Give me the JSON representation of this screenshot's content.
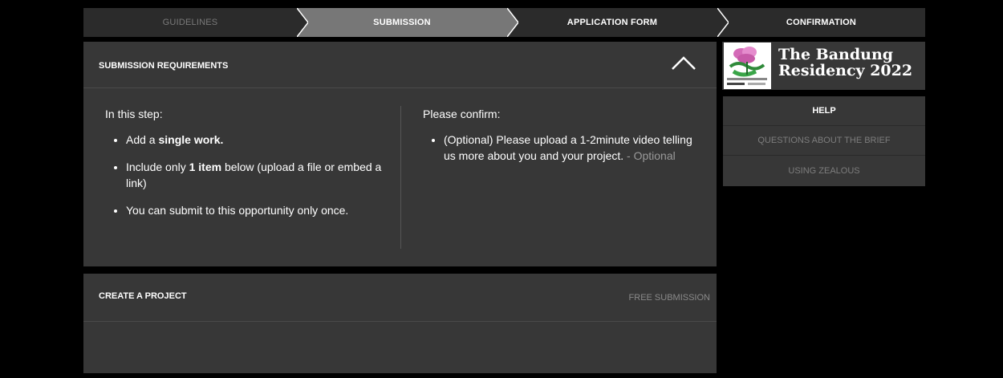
{
  "stepper": {
    "steps": [
      {
        "label": "GUIDELINES"
      },
      {
        "label": "SUBMISSION"
      },
      {
        "label": "APPLICATION FORM"
      },
      {
        "label": "CONFIRMATION"
      }
    ],
    "active_index": 1
  },
  "requirements": {
    "title": "SUBMISSION REQUIREMENTS",
    "left": {
      "heading": "In this step:",
      "items": [
        {
          "before": "Add a ",
          "bold": "single work.",
          "after": ""
        },
        {
          "before": "Include only ",
          "bold": "1 item",
          "after": " below (upload a file or embed a link)"
        },
        {
          "before": "You can submit to this opportunity only once.",
          "bold": "",
          "after": ""
        }
      ]
    },
    "right": {
      "heading": "Please confirm:",
      "items": [
        {
          "text": "(Optional) Please upload a 1-2minute video telling us more about you and your project.",
          "suffix": " - Optional"
        }
      ]
    }
  },
  "create_project": {
    "title": "CREATE A PROJECT",
    "badge": "FREE SUBMISSION"
  },
  "brand": {
    "title_line1": "The Bandung",
    "title_line2": "Residency 2022",
    "logo_icon": "flower-logo-icon"
  },
  "help": {
    "heading": "HELP",
    "items": [
      {
        "label": "QUESTIONS ABOUT THE BRIEF"
      },
      {
        "label": "USING ZEALOUS"
      }
    ]
  },
  "colors": {
    "background": "#000000",
    "panel": "#373737",
    "active_step": "#777777",
    "muted_text": "#999999"
  }
}
